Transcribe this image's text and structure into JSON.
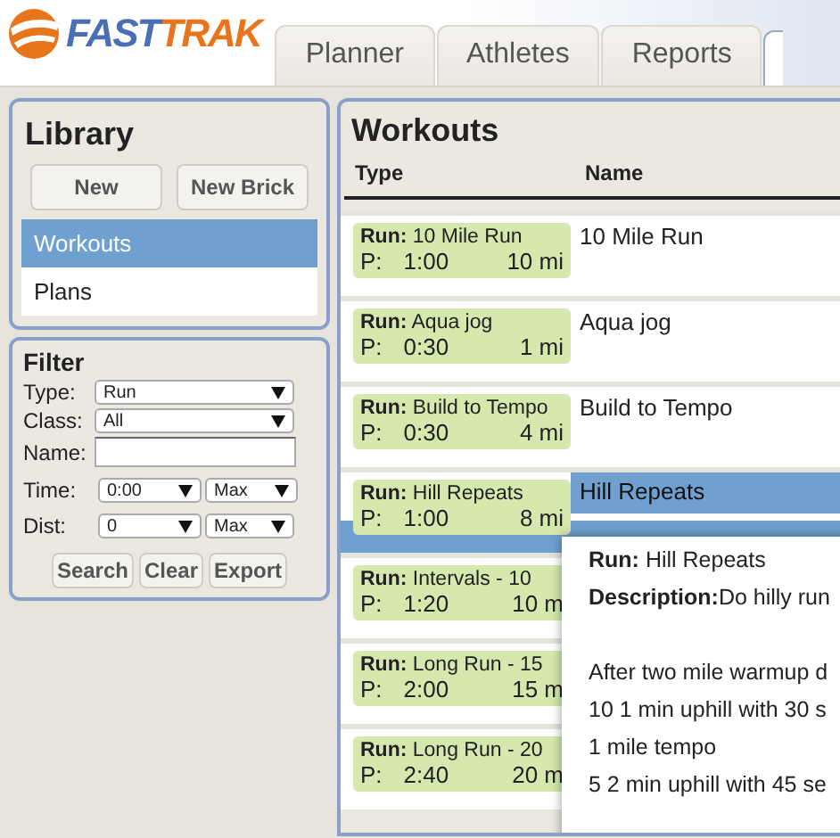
{
  "logo": {
    "part_1": "FAST",
    "part_2": "TRAK"
  },
  "tabs": [
    {
      "label": "Planner",
      "selected": false
    },
    {
      "label": "Athletes",
      "selected": false
    },
    {
      "label": "Reports",
      "selected": false
    }
  ],
  "library": {
    "title": "Library",
    "buttons": [
      "New",
      "New Brick"
    ],
    "items": [
      {
        "label": "Workouts",
        "selected": true
      },
      {
        "label": "Plans",
        "selected": false
      }
    ]
  },
  "filter": {
    "title": "Filter",
    "fields": [
      {
        "kind": "select",
        "label": "Type:",
        "value": "Run"
      },
      {
        "kind": "select",
        "label": "Class:",
        "value": "All"
      },
      {
        "kind": "text",
        "label": "Name:"
      },
      {
        "kind": "range",
        "label": "Time:",
        "from": "0:00",
        "to": "Max"
      },
      {
        "kind": "range",
        "label": "Dist:",
        "from": "0",
        "to": "Max"
      }
    ],
    "buttons": [
      "Search",
      "Clear",
      "Export"
    ]
  },
  "workouts": {
    "title": "Workouts",
    "columns": [
      "Type",
      "Name"
    ],
    "rows": [
      {
        "card": "**Run:** 10 Mile Run",
        "prefix": "P:",
        "time": "1:00",
        "dist": "10 mi",
        "name": "10 Mile Run",
        "selected": false
      },
      {
        "card": "**Run:** Aqua jog",
        "prefix": "P:",
        "time": "0:30",
        "dist": "1 mi",
        "name": "Aqua jog",
        "selected": false
      },
      {
        "card": "**Run:** Build to Tempo",
        "prefix": "P:",
        "time": "0:30",
        "dist": "4 mi",
        "name": "Build to Tempo",
        "selected": false
      },
      {
        "card": "**Run:** Hill Repeats",
        "prefix": "P:",
        "time": "1:00",
        "dist": "8 mi",
        "name": "Hill Repeats",
        "selected": true
      },
      {
        "card": "**Run:** Intervals - 10",
        "prefix": "P:",
        "time": "1:20",
        "dist": "10 m",
        "selected": false
      },
      {
        "card": "**Run:** Long Run - 15",
        "prefix": "P:",
        "time": "2:00",
        "dist": "15 m",
        "selected": false
      },
      {
        "card": "**Run:** Long Run - 20",
        "prefix": "P:",
        "time": "2:40",
        "dist": "20 m",
        "selected": false
      }
    ]
  },
  "tooltip": {
    "header": [
      "**Run:** Hill Repeats",
      "**Description:**Do hilly run"
    ],
    "body": [
      "After two mile warmup d",
      "10 1 min uphill with 30 s",
      "1 mile tempo",
      "5 2 min uphill with 45 se"
    ]
  }
}
